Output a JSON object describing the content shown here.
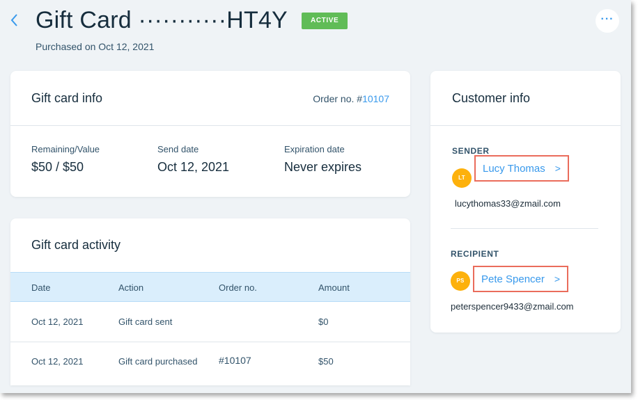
{
  "header": {
    "title": "Gift Card ···········HT4Y",
    "status_badge": "ACTIVE",
    "subtitle": "Purchased on Oct 12, 2021",
    "more_label": "···"
  },
  "gift_card_info": {
    "title": "Gift card info",
    "order_prefix": "Order no. #",
    "order_number": "10107",
    "fields": [
      {
        "label": "Remaining/Value",
        "value": "$50 / $50"
      },
      {
        "label": "Send date",
        "value": "Oct 12, 2021"
      },
      {
        "label": "Expiration date",
        "value": "Never expires"
      }
    ]
  },
  "activity": {
    "title": "Gift card activity",
    "columns": [
      "Date",
      "Action",
      "Order no.",
      "Amount"
    ],
    "rows": [
      {
        "date": "Oct 12, 2021",
        "action": "Gift card sent",
        "order": "",
        "amount": "$0"
      },
      {
        "date": "Oct 12, 2021",
        "action": "Gift card purchased",
        "order": "#10107",
        "amount": "$50"
      }
    ]
  },
  "customer_info": {
    "title": "Customer info",
    "sender": {
      "section_label": "SENDER",
      "initials": "LT",
      "name": "Lucy Thomas",
      "email": "lucythomas33@zmail.com"
    },
    "recipient": {
      "section_label": "RECIPIENT",
      "initials": "PS",
      "name": "Pete Spencer",
      "email": "peterspencer9433@zmail.com"
    }
  },
  "colors": {
    "accent": "#3899ec",
    "badge_green": "#60bc57",
    "avatar_yellow": "#fdb10c",
    "highlight_border": "#ea6c5b",
    "page_bg": "#eff3f6",
    "table_header_bg": "#daeefc"
  },
  "icons": {
    "back": "chevron-left-icon",
    "more": "more-dots-icon",
    "person_chevron": "chevron-right-icon"
  }
}
